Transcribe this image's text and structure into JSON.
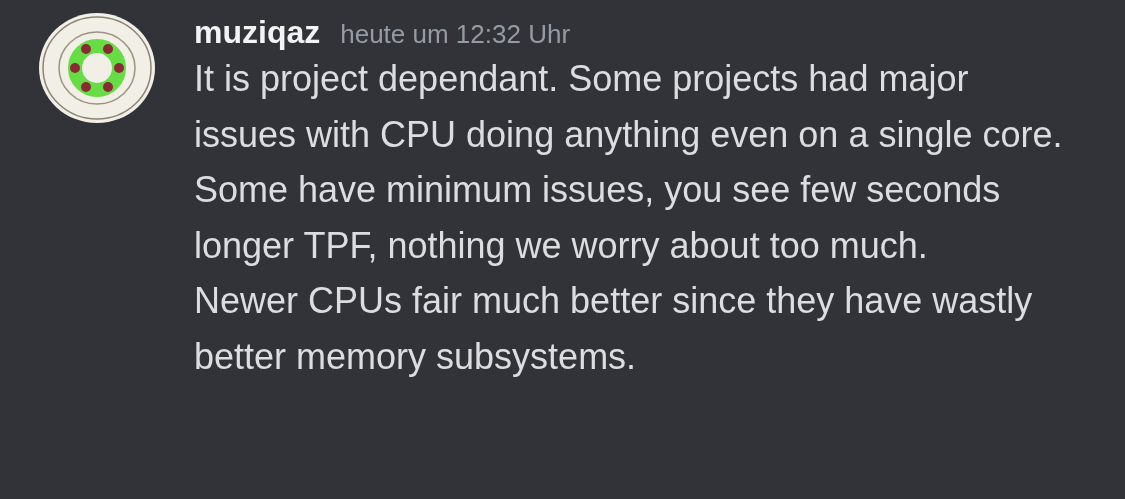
{
  "message": {
    "author": "muziqaz",
    "timestamp": "heute um 12:32 Uhr",
    "paragraphs": [
      "It is project dependant. Some projects had major issues with CPU doing anything even on a single core. Some have minimum issues, you see few seconds longer TPF, nothing we worry about too much.",
      "Newer CPUs fair much better since they have wastly better memory subsystems."
    ]
  }
}
